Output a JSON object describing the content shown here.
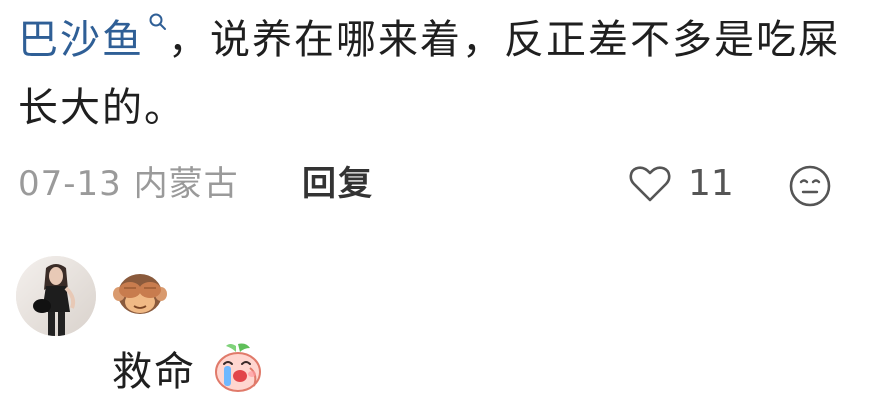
{
  "comment": {
    "topic_link": "巴沙鱼",
    "body_rest": "，说养在哪来着，反正差不多是吃屎长大的。"
  },
  "meta": {
    "date_location": "07-13 内蒙古",
    "reply_label": "回复",
    "like_count": "11"
  },
  "reply": {
    "user_emoji": "see-no-evil-monkey",
    "text": "救命",
    "sticker": "crying-peach-sticker"
  },
  "icons": {
    "like": "heart-outline-icon",
    "emoji": "neutral-face-icon",
    "search": "search-icon"
  },
  "colors": {
    "link": "#2f5f96",
    "meta": "#9a9a9a",
    "reply_label": "#333333"
  }
}
